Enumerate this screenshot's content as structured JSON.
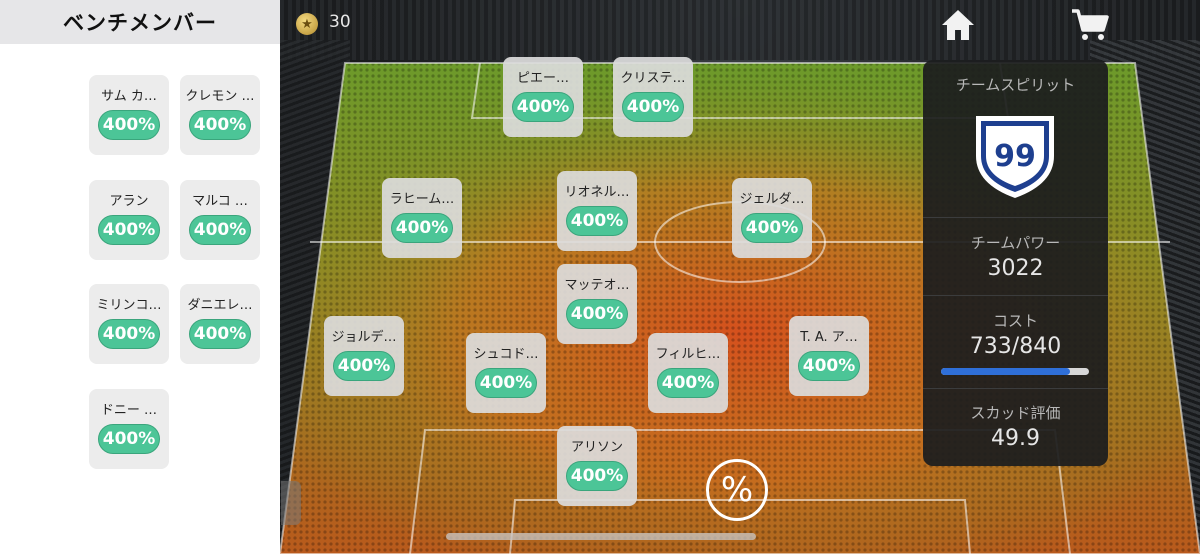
{
  "bench": {
    "title": "ベンチメンバー",
    "players": [
      {
        "name": "サム カ…",
        "rating": "400%"
      },
      {
        "name": "クレモン …",
        "rating": "400%"
      },
      {
        "name": "アラン",
        "rating": "400%"
      },
      {
        "name": "マルコ …",
        "rating": "400%"
      },
      {
        "name": "ミリンコ…",
        "rating": "400%"
      },
      {
        "name": "ダニエレ…",
        "rating": "400%"
      },
      {
        "name": "ドニー …",
        "rating": "400%"
      }
    ]
  },
  "topbar": {
    "coins": "30",
    "home_icon": "home-icon",
    "cart_icon": "cart-icon",
    "coin_icon": "star-coin-icon"
  },
  "field": {
    "players": [
      {
        "name": "ピエー…",
        "rating": "400%"
      },
      {
        "name": "クリステ…",
        "rating": "400%"
      },
      {
        "name": "ラヒーム…",
        "rating": "400%"
      },
      {
        "name": "リオネル…",
        "rating": "400%"
      },
      {
        "name": "ジェルダ…",
        "rating": "400%"
      },
      {
        "name": "マッテオ…",
        "rating": "400%"
      },
      {
        "name": "ジョルデ…",
        "rating": "400%"
      },
      {
        "name": "シュコド…",
        "rating": "400%"
      },
      {
        "name": "フィルヒ…",
        "rating": "400%"
      },
      {
        "name": "T. A. ア…",
        "rating": "400%"
      },
      {
        "name": "アリソン",
        "rating": "400%"
      }
    ],
    "percent_button": "%"
  },
  "stats": {
    "spirit_label": "チームスピリット",
    "spirit_value": "99",
    "power_label": "チームパワー",
    "power_value": "3022",
    "cost_label": "コスト",
    "cost_value": "733/840",
    "cost_fraction": 0.873,
    "squad_label": "スカッド評価",
    "squad_value": "49.9"
  },
  "colors": {
    "badge": "#4cc597",
    "cost_bar": "#2f6fd8",
    "shield_blue": "#1e3f8f"
  }
}
